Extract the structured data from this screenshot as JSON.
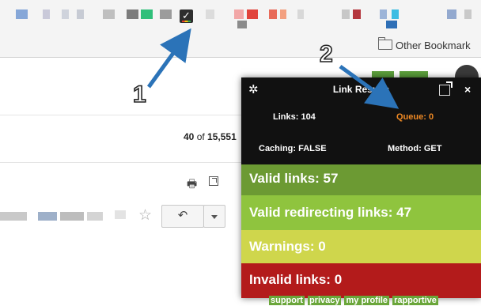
{
  "colors": {
    "valid": "#6c9a33",
    "redirecting": "#8fc43e",
    "warnings": "#cfd64c",
    "invalid": "#b31b1b",
    "queue": "#f08a24",
    "arrow": "#2b73b8"
  },
  "toolbar": {
    "extension_icon": "checkmark-icon"
  },
  "bookmarks": {
    "other_label": "Other Bookmark"
  },
  "gmail": {
    "count_prefix": "40",
    "count_sep": " of ",
    "count_total": "15,551",
    "star_icon": "☆",
    "reply_icon": "↶",
    "print_icon": "🖶"
  },
  "annotations": {
    "one": "1",
    "two": "2"
  },
  "popup": {
    "title": "Link Results",
    "gear_icon": "✲",
    "close_icon": "×",
    "links": "Links: 104",
    "queue": "Queue: 0",
    "caching": "Caching: FALSE",
    "method": "Method: GET",
    "valid": "Valid links: 57",
    "redirecting": "Valid redirecting links: 47",
    "warnings": "Warnings: 0",
    "invalid": "Invalid links: 0"
  },
  "footer": {
    "support": "support",
    "privacy": "privacy",
    "profile": "my profile",
    "rapportive": "rapportive"
  }
}
